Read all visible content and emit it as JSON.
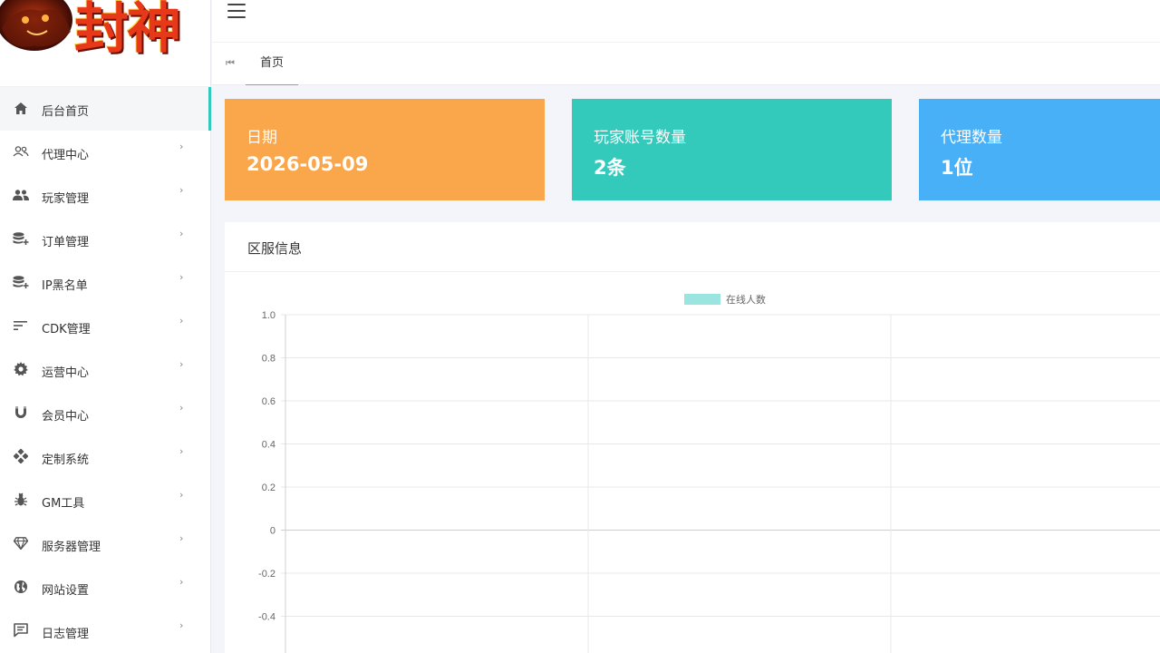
{
  "logo": {
    "text": "封神"
  },
  "sidebar": {
    "items": [
      {
        "label": "后台首页",
        "icon": "home-icon",
        "active": true,
        "has_arrow": false
      },
      {
        "label": "代理中心",
        "icon": "users-outline-icon",
        "has_arrow": true
      },
      {
        "label": "玩家管理",
        "icon": "users-icon",
        "has_arrow": true
      },
      {
        "label": "订单管理",
        "icon": "database-plus-icon",
        "has_arrow": true
      },
      {
        "label": "IP黑名单",
        "icon": "database-plus-icon",
        "has_arrow": true
      },
      {
        "label": "CDK管理",
        "icon": "sort-lines-icon",
        "has_arrow": true
      },
      {
        "label": "运营中心",
        "icon": "gear-icon",
        "has_arrow": true
      },
      {
        "label": "会员中心",
        "icon": "magnet-icon",
        "has_arrow": true
      },
      {
        "label": "定制系统",
        "icon": "gamepad-icon",
        "has_arrow": true
      },
      {
        "label": "GM工具",
        "icon": "bug-icon",
        "has_arrow": true
      },
      {
        "label": "服务器管理",
        "icon": "diamond-icon",
        "has_arrow": true
      },
      {
        "label": "网站设置",
        "icon": "globe-icon",
        "has_arrow": true
      },
      {
        "label": "日志管理",
        "icon": "comment-icon",
        "has_arrow": true
      }
    ],
    "arrow": "›"
  },
  "tabs": {
    "first_icon": "⏮",
    "items": [
      {
        "label": "首页"
      }
    ]
  },
  "cards": [
    {
      "title": "日期",
      "value": "2026-05-09",
      "color": "#faa64b"
    },
    {
      "title": "玩家账号数量",
      "value": "2条",
      "color": "#33cabb"
    },
    {
      "title": "代理数量",
      "value": "1位",
      "color": "#48b0f7"
    }
  ],
  "panel": {
    "title": "区服信息"
  },
  "chart_data": {
    "type": "line",
    "series": [
      {
        "name": "在线人数",
        "values": [],
        "color": "#9ae5df"
      }
    ],
    "x": [],
    "ylim": [
      -0.4,
      1.0
    ],
    "yticks": [
      "1.0",
      "0.8",
      "0.6",
      "0.4",
      "0.2",
      "0",
      "-0.2",
      "-0.4"
    ],
    "grid": true,
    "legend": "top"
  },
  "colors": {
    "accent": "#33cabb",
    "orange": "#faa64b",
    "blue": "#48b0f7"
  }
}
